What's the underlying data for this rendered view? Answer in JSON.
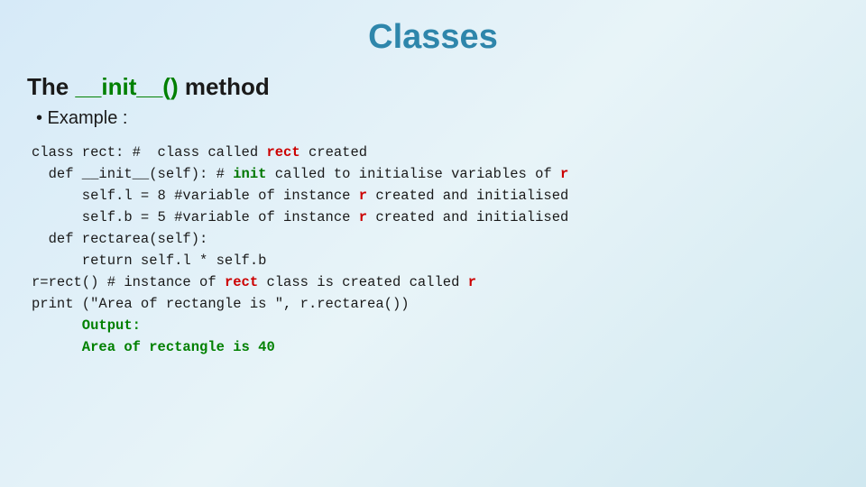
{
  "page": {
    "title": "Classes",
    "subtitle_prefix": "The ",
    "subtitle_method": "__init__()",
    "subtitle_suffix": " method",
    "bullet": "• Example :",
    "code": {
      "line1": "class rect: #  class called ",
      "line1_red": "rect",
      "line1_end": " created",
      "line2_pre": "  def __init__(self): # ",
      "line2_green": "init",
      "line2_mid": " called to initialise variables of ",
      "line2_red": "r",
      "line3_pre": "      self.l = 8 #variable of instance ",
      "line3_red": "r",
      "line3_end": " created and initialised",
      "line4_pre": "      self.b = 5 #variable of instance ",
      "line4_red": "r",
      "line4_end": " created and initialised",
      "line5": "  def rectarea(self):",
      "line6": "      return self.l * self.b",
      "line7_pre": "r=rect() # instance of ",
      "line7_red": "rect",
      "line7_mid": " class is created called ",
      "line7_red2": "r",
      "line8": "print (\"Area of rectangle is \", r.rectarea())",
      "output_label": "      Output:",
      "output_value": "      Area of rectangle is 40"
    }
  }
}
